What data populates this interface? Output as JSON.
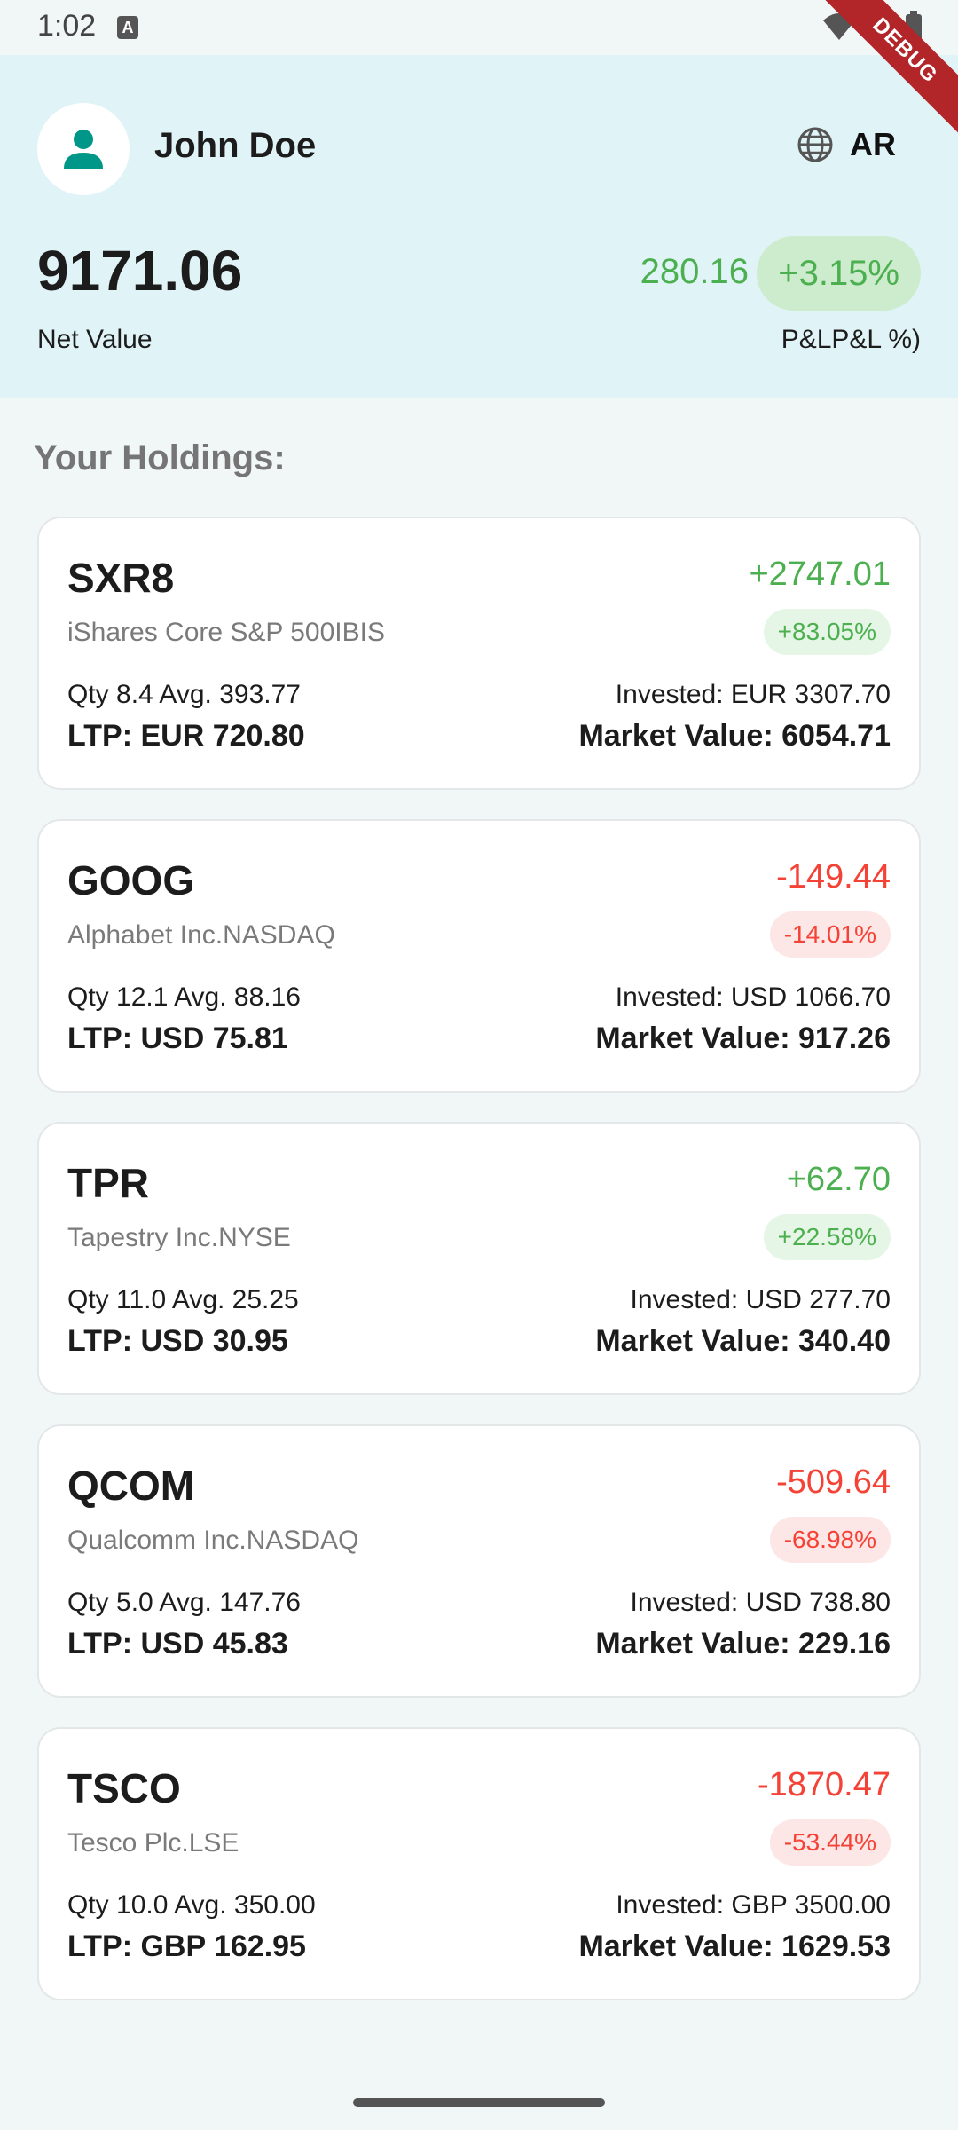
{
  "status_bar": {
    "time": "1:02",
    "notification_icon_letter": "A",
    "debug_label": "DEBUG"
  },
  "header": {
    "user_name": "John Doe",
    "language": "AR",
    "net_value": "9171.06",
    "net_value_label": "Net Value",
    "pl_value": "280.16",
    "pl_percent": "+3.15%",
    "pl_label": "P&LP&L %)"
  },
  "holdings": {
    "title": "Your Holdings:",
    "items": [
      {
        "symbol": "SXR8",
        "name": "iShares Core S&P 500IBIS",
        "pl": "+2747.01",
        "pl_percent": "+83.05%",
        "qty_avg": "Qty 8.4 Avg. 393.77",
        "invested": "Invested: EUR 3307.70",
        "ltp": "LTP: EUR 720.80",
        "market_value": "Market Value: 6054.71"
      },
      {
        "symbol": "GOOG",
        "name": "Alphabet Inc.NASDAQ",
        "pl": "-149.44",
        "pl_percent": "-14.01%",
        "qty_avg": "Qty 12.1 Avg. 88.16",
        "invested": "Invested: USD 1066.70",
        "ltp": "LTP: USD 75.81",
        "market_value": "Market Value: 917.26"
      },
      {
        "symbol": "TPR",
        "name": "Tapestry Inc.NYSE",
        "pl": "+62.70",
        "pl_percent": "+22.58%",
        "qty_avg": "Qty 11.0 Avg. 25.25",
        "invested": "Invested: USD 277.70",
        "ltp": "LTP: USD 30.95",
        "market_value": "Market Value: 340.40"
      },
      {
        "symbol": "QCOM",
        "name": "Qualcomm Inc.NASDAQ",
        "pl": "-509.64",
        "pl_percent": "-68.98%",
        "qty_avg": "Qty 5.0 Avg. 147.76",
        "invested": "Invested: USD 738.80",
        "ltp": "LTP: USD 45.83",
        "market_value": "Market Value: 229.16"
      },
      {
        "symbol": "TSCO",
        "name": "Tesco Plc.LSE",
        "pl": "-1870.47",
        "pl_percent": "-53.44%",
        "qty_avg": "Qty 10.0 Avg. 350.00",
        "invested": "Invested: GBP 3500.00",
        "ltp": "LTP: GBP 162.95",
        "market_value": "Market Value: 1629.53"
      }
    ]
  },
  "colors": {
    "positive": "#4caf50",
    "negative": "#f44336",
    "header_bg": "#e0f3f7",
    "avatar_icon": "#009688"
  }
}
